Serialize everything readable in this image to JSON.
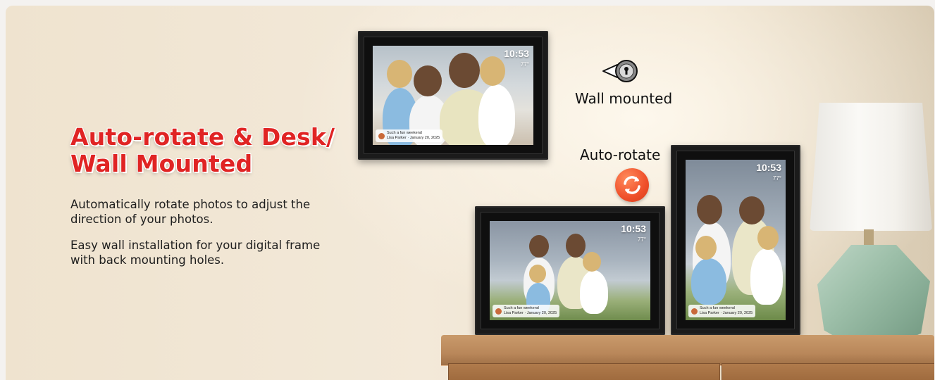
{
  "headline": {
    "line1": "Auto-rotate & Desk/",
    "line2": "Wall Mounted"
  },
  "description": {
    "p1": "Automatically rotate photos to adjust the direction of your photos.",
    "p2": "Easy wall installation for your digital frame with back mounting holes."
  },
  "features": {
    "wall_mounted": "Wall mounted",
    "auto_rotate": "Auto-rotate"
  },
  "frames": {
    "clock_time": "10:53",
    "clock_temp": "77°",
    "caption_title": "Such a fun weekend",
    "caption_sub": "Lisa Parker · January 20, 2025"
  },
  "colors": {
    "headline": "#e02424",
    "accent": "#ef4f2a"
  }
}
